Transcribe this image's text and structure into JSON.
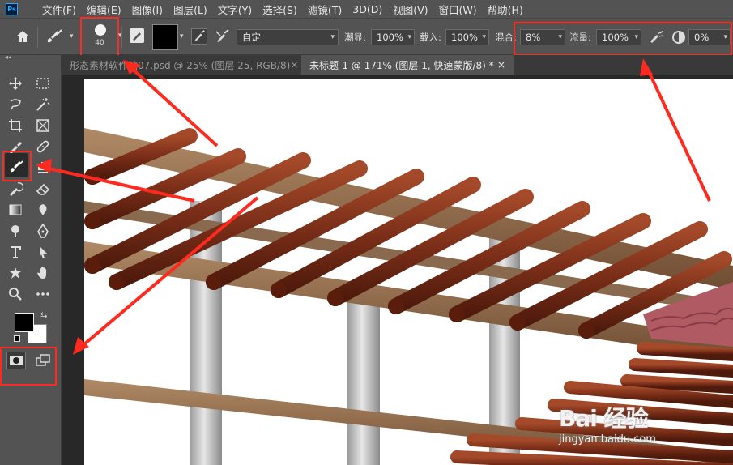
{
  "app": {
    "logo": "Ps"
  },
  "menu": [
    "文件(F)",
    "编辑(E)",
    "图像(I)",
    "图层(L)",
    "文字(Y)",
    "选择(S)",
    "滤镜(T)",
    "3D(D)",
    "视图(V)",
    "窗口(W)",
    "帮助(H)"
  ],
  "options": {
    "brush_size": "40",
    "mode_value": "自定",
    "smoothing_label": "潮显:",
    "smoothing_value": "100%",
    "load_label": "载入:",
    "load_value": "100%",
    "mix_label": "混合:",
    "mix_value": "8%",
    "flow_label": "流量:",
    "flow_value": "100%",
    "angle_value": "0%"
  },
  "tabs": [
    {
      "label": "形态素材软件站07.psd @ 25% (图层 25, RGB/8)",
      "close": "×"
    },
    {
      "label": "未标题-1 @ 171% (图层 1, 快速蒙版/8) *",
      "close": "×"
    }
  ],
  "watermark": {
    "logo": "Bai 经验",
    "url": "jingyan.baidu.com"
  },
  "colors": {
    "highlight": "#ff2a1f",
    "panel": "#535353",
    "canvas": "#ffffff",
    "fg_color": "#000000",
    "bg_color": "#ffffff"
  },
  "tools": [
    "move-icon",
    "marquee-icon",
    "lasso-icon",
    "magic-wand-icon",
    "crop-icon",
    "frame-icon",
    "eyedropper-icon",
    "healing-icon",
    "mixer-brush-icon",
    "clone-stamp-icon",
    "history-brush-icon",
    "eraser-icon",
    "gradient-icon",
    "smudge-icon",
    "dodge-icon",
    "pen-icon",
    "type-icon",
    "path-select-icon",
    "shape-icon",
    "hand-icon",
    "zoom-icon",
    "more-icon",
    "quick-mask-icon",
    "screen-mode-icon"
  ]
}
